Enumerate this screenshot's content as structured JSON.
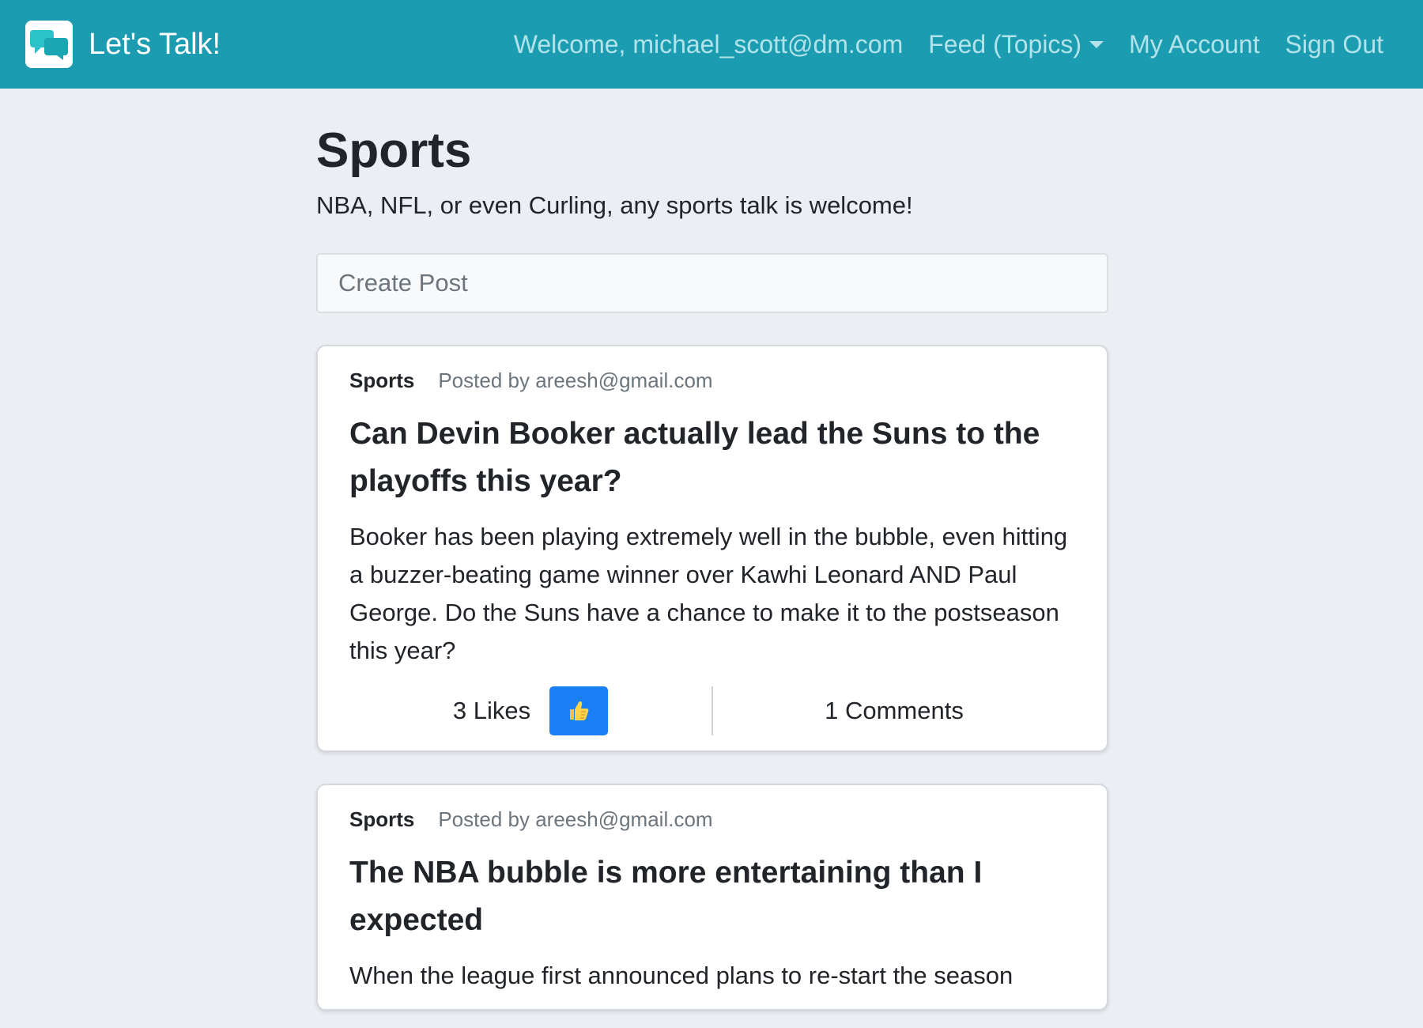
{
  "navbar": {
    "brand": "Let's Talk!",
    "logo_icon": "chat-bubbles-icon",
    "welcome": "Welcome, michael_scott@dm.com",
    "feed_link": "Feed (Topics)",
    "account_link": "My Account",
    "signout_link": "Sign Out",
    "bg_color": "#1b9cb0"
  },
  "topic": {
    "title": "Sports",
    "description": "NBA, NFL, or even Curling, any sports talk is welcome!"
  },
  "create_post": {
    "placeholder": "Create Post"
  },
  "posts": [
    {
      "topic": "Sports",
      "author": "Posted by areesh@gmail.com",
      "title": "Can Devin Booker actually lead the Suns to the playoffs this year?",
      "body": "Booker has been playing extremely well in the bubble, even hitting a buzzer-beating game winner over Kawhi Leonard AND Paul George. Do the Suns have a chance to make it to the postseason this year?",
      "likes": "3 Likes",
      "like_icon": "thumbs-up-icon",
      "comments": "1 Comments"
    },
    {
      "topic": "Sports",
      "author": "Posted by areesh@gmail.com",
      "title": "The NBA bubble is more entertaining than I expected",
      "body": "When the league first announced plans to re-start the season"
    }
  ]
}
